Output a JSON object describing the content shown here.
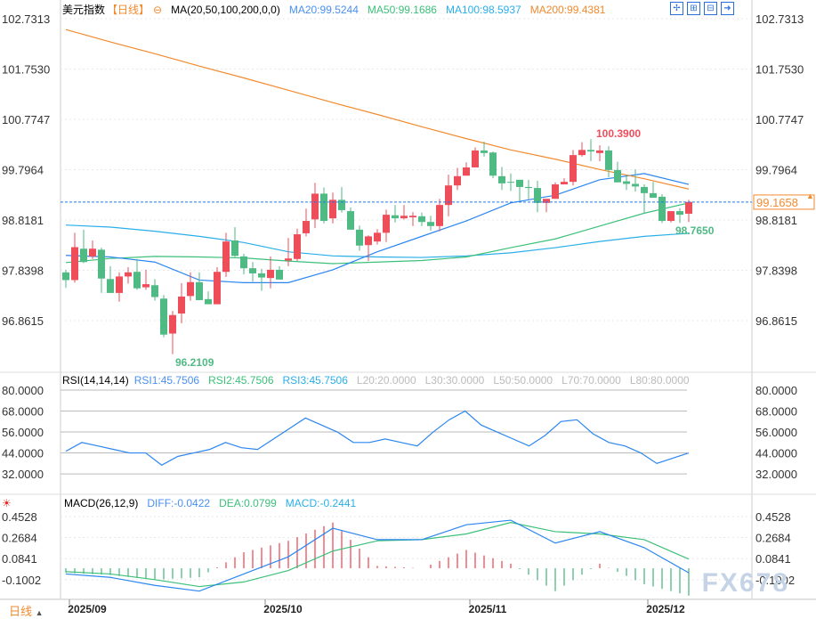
{
  "header": {
    "title": "美元指数",
    "period": "【日线】",
    "ma_label": "MA(20,50,100,200,0,0)",
    "ma20": "MA20:99.5244",
    "ma50": "MA50:99.1686",
    "ma100": "MA100:98.5937",
    "ma200": "MA200:99.4381",
    "toolbar_icons": [
      "crosshair-icon",
      "zoom-in-icon",
      "zoom-out-icon",
      "export-icon"
    ]
  },
  "colors": {
    "up": "#ee4d5a",
    "down": "#4fba84",
    "ma20": "#2b86f0",
    "ma50": "#3cc07a",
    "ma100": "#2aaee8",
    "ma200": "#f28a2e"
  },
  "price_axis": {
    "labels": [
      "102.7313",
      "101.7530",
      "100.7747",
      "99.7964",
      "98.8181",
      "97.8398",
      "96.8615"
    ],
    "current": "99.1658",
    "high_label": "100.3900",
    "low_label": "96.2109",
    "recent_low_label": "98.7650"
  },
  "rsi": {
    "label": "RSI(14,14,14)",
    "rsi1": "RSI1:45.7506",
    "rsi2": "RSI2:45.7506",
    "rsi3": "RSI3:45.7506",
    "l20": "L20:20.0000",
    "l30": "L30:30.0000",
    "l50": "L50:50.0000",
    "l70": "L70:70.0000",
    "l80": "L80:80.0000",
    "axis": [
      "80.0000",
      "68.0000",
      "56.0000",
      "44.0000",
      "32.0000"
    ],
    "values": [
      45,
      50,
      48,
      46,
      44,
      44,
      37,
      42,
      44,
      46,
      50,
      47,
      46,
      52,
      58,
      64,
      60,
      56,
      50,
      50,
      52,
      50,
      48,
      56,
      63,
      68,
      60,
      56,
      52,
      48,
      54,
      62,
      63,
      55,
      50,
      48,
      44,
      38,
      41,
      44
    ]
  },
  "macd": {
    "label": "MACD(26,12,9)",
    "diff": "DIFF:-0.0422",
    "dea": "DEA:0.0799",
    "macd": "MACD:-0.2441",
    "axis": [
      "0.4528",
      "0.2684",
      "0.0841",
      "-0.1002"
    ],
    "diff_values": [
      -0.05,
      -0.08,
      -0.15,
      -0.2,
      -0.05,
      0.1,
      0.35,
      0.25,
      0.25,
      0.38,
      0.42,
      0.22,
      0.32,
      0.18,
      -0.04
    ],
    "dea_values": [
      -0.03,
      -0.05,
      -0.1,
      -0.16,
      -0.12,
      -0.02,
      0.15,
      0.24,
      0.25,
      0.3,
      0.4,
      0.32,
      0.3,
      0.25,
      0.08
    ]
  },
  "x_axis": [
    "2025/09",
    "2025/10",
    "2025/11",
    "2025/12"
  ],
  "bottom": {
    "period_button": "日线"
  },
  "watermark": "FX678",
  "chart_data": {
    "type": "candlestick",
    "ohlc": [
      [
        97.8,
        97.85,
        97.5,
        97.65
      ],
      [
        97.65,
        98.57,
        97.6,
        98.29
      ],
      [
        98.26,
        98.63,
        97.98,
        98.0
      ],
      [
        98.11,
        98.42,
        98.06,
        98.26
      ],
      [
        98.24,
        98.28,
        97.4,
        97.68
      ],
      [
        97.67,
        97.92,
        97.4,
        97.4
      ],
      [
        97.4,
        97.8,
        97.23,
        97.72
      ],
      [
        97.72,
        97.9,
        97.58,
        97.8
      ],
      [
        97.81,
        98.06,
        97.46,
        97.49
      ],
      [
        97.51,
        97.85,
        97.46,
        97.57
      ],
      [
        97.55,
        97.67,
        97.25,
        97.32
      ],
      [
        97.29,
        97.36,
        96.54,
        96.59
      ],
      [
        96.61,
        97.05,
        96.21,
        96.97
      ],
      [
        97.0,
        97.59,
        96.81,
        97.33
      ],
      [
        97.34,
        97.8,
        97.25,
        97.61
      ],
      [
        97.61,
        97.8,
        97.26,
        97.26
      ],
      [
        97.28,
        97.43,
        97.18,
        97.18
      ],
      [
        97.18,
        97.9,
        97.18,
        97.81
      ],
      [
        97.81,
        98.57,
        97.71,
        98.4
      ],
      [
        98.42,
        98.68,
        98.1,
        98.12
      ],
      [
        98.11,
        98.16,
        97.76,
        97.88
      ],
      [
        97.88,
        98.0,
        97.62,
        97.78
      ],
      [
        97.78,
        97.87,
        97.44,
        97.7
      ],
      [
        97.69,
        98.11,
        97.49,
        97.85
      ],
      [
        97.85,
        97.92,
        97.66,
        97.66
      ],
      [
        98.03,
        98.47,
        97.92,
        98.07
      ],
      [
        98.06,
        98.65,
        98.02,
        98.54
      ],
      [
        98.56,
        99.04,
        98.5,
        98.8
      ],
      [
        98.83,
        99.54,
        98.66,
        99.33
      ],
      [
        99.33,
        99.45,
        98.75,
        98.8
      ],
      [
        98.85,
        99.35,
        98.75,
        99.21
      ],
      [
        99.21,
        99.46,
        98.96,
        99.01
      ],
      [
        98.99,
        99.06,
        98.63,
        98.63
      ],
      [
        98.63,
        98.71,
        98.22,
        98.32
      ],
      [
        98.33,
        98.52,
        98.02,
        98.5
      ],
      [
        98.4,
        98.64,
        98.34,
        98.57
      ],
      [
        98.57,
        99.02,
        98.39,
        98.92
      ],
      [
        98.91,
        99.11,
        98.77,
        98.85
      ],
      [
        98.85,
        99.11,
        98.83,
        98.9
      ],
      [
        98.87,
        98.97,
        98.7,
        98.9
      ],
      [
        98.89,
        98.96,
        98.7,
        98.78
      ],
      [
        98.78,
        98.9,
        98.61,
        98.7
      ],
      [
        98.7,
        99.23,
        98.6,
        99.11
      ],
      [
        99.11,
        99.7,
        98.89,
        99.49
      ],
      [
        99.49,
        99.83,
        99.4,
        99.67
      ],
      [
        99.68,
        99.94,
        99.68,
        99.84
      ],
      [
        99.84,
        100.23,
        99.84,
        100.17
      ],
      [
        100.17,
        100.34,
        100.05,
        100.12
      ],
      [
        100.13,
        100.15,
        99.63,
        99.68
      ],
      [
        99.67,
        99.85,
        99.4,
        99.53
      ],
      [
        99.56,
        99.72,
        99.38,
        99.55
      ],
      [
        99.6,
        99.6,
        99.18,
        99.46
      ],
      [
        99.46,
        99.6,
        99.22,
        99.44
      ],
      [
        99.44,
        99.58,
        98.97,
        99.15
      ],
      [
        99.15,
        99.23,
        98.97,
        99.23
      ],
      [
        99.23,
        99.55,
        99.23,
        99.51
      ],
      [
        99.51,
        99.63,
        99.51,
        99.56
      ],
      [
        99.56,
        100.18,
        99.49,
        100.08
      ],
      [
        100.08,
        100.33,
        100.05,
        100.18
      ],
      [
        100.18,
        100.39,
        99.96,
        100.15
      ],
      [
        100.12,
        100.27,
        99.96,
        100.17
      ],
      [
        100.17,
        100.25,
        99.65,
        99.79
      ],
      [
        99.79,
        99.95,
        99.55,
        99.55
      ],
      [
        99.57,
        99.7,
        99.4,
        99.52
      ],
      [
        99.52,
        99.8,
        99.37,
        99.47
      ],
      [
        99.46,
        99.51,
        98.94,
        99.34
      ],
      [
        99.34,
        99.56,
        99.25,
        99.25
      ],
      [
        99.27,
        99.32,
        98.76,
        98.8
      ],
      [
        98.8,
        98.99,
        98.77,
        98.99
      ],
      [
        98.99,
        99.05,
        98.76,
        98.92
      ],
      [
        98.94,
        99.21,
        98.78,
        99.17
      ]
    ],
    "ma20": [
      98.13,
      98.1,
      98.0,
      97.65,
      97.6,
      97.6,
      97.85,
      98.2,
      98.5,
      98.8,
      99.15,
      99.3,
      99.6,
      99.72,
      99.51
    ],
    "ma50": [
      97.99,
      98.07,
      98.11,
      98.1,
      98.08,
      98.02,
      97.97,
      98.0,
      98.03,
      98.1,
      98.28,
      98.45,
      98.7,
      98.95,
      99.15
    ],
    "ma100": [
      98.72,
      98.68,
      98.6,
      98.5,
      98.38,
      98.2,
      98.12,
      98.1,
      98.09,
      98.12,
      98.18,
      98.28,
      98.4,
      98.5,
      98.56
    ],
    "ma200": [
      102.52,
      102.28,
      102.05,
      101.81,
      101.58,
      101.34,
      101.1,
      100.87,
      100.63,
      100.4,
      100.18,
      100.0,
      99.8,
      99.62,
      99.42
    ],
    "ylim": [
      96.8615,
      102.7313
    ]
  }
}
